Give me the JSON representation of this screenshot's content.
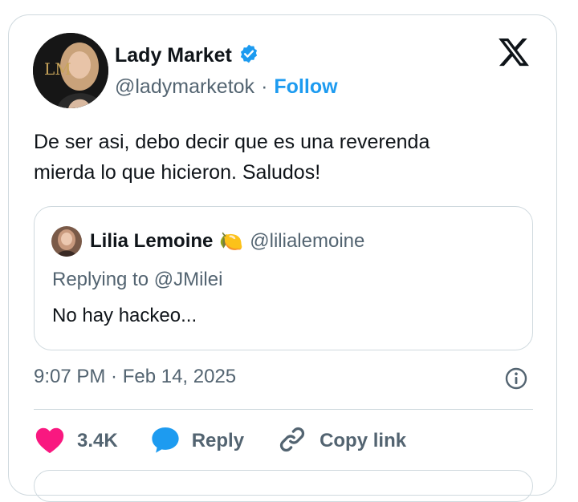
{
  "author": {
    "display_name": "Lady Market",
    "handle": "@ladymarketok",
    "separator": "·",
    "follow_label": "Follow",
    "avatar_monogram": "LM",
    "verified_icon": "verified-badge-icon"
  },
  "brand": {
    "logo_icon": "x-logo-icon"
  },
  "tweet": {
    "text_line1": "De ser asi, debo decir que es una reverenda",
    "text_line2": "mierda lo que hicieron. Saludos!",
    "timestamp": "9:07 PM · Feb 14, 2025"
  },
  "quoted": {
    "display_name": "Lilia Lemoine",
    "emoji": "🍋",
    "handle": "@lilialemoine",
    "replying_to": "Replying to @JMilei",
    "text": "No hay hackeo..."
  },
  "actions": {
    "likes_count": "3.4K",
    "reply_label": "Reply",
    "copy_link_label": "Copy link"
  },
  "colors": {
    "accent": "#1d9bf0",
    "like": "#f91880",
    "text": "#0f1419",
    "muted": "#536471",
    "border": "#cfd9de"
  }
}
